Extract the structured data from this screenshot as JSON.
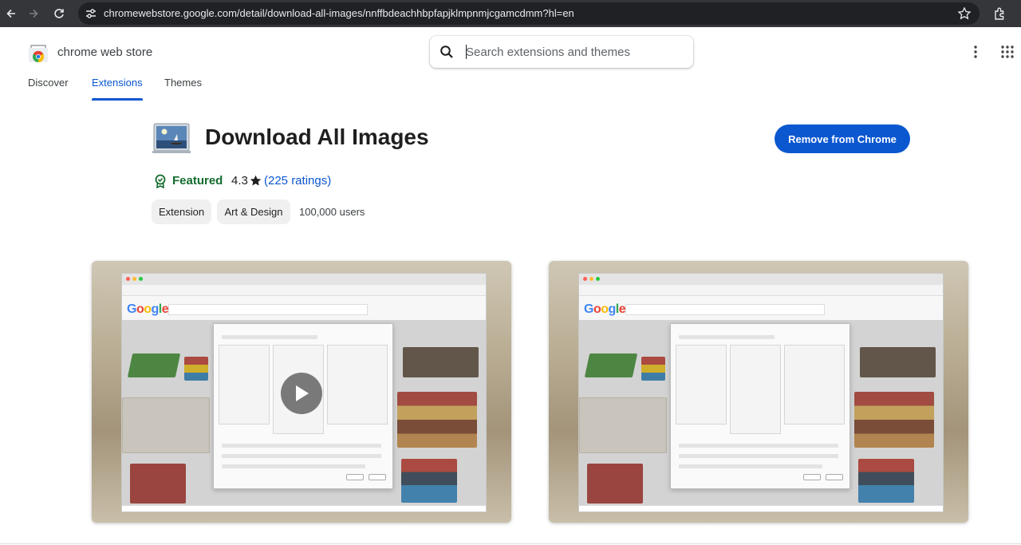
{
  "browser": {
    "url": "chromewebstore.google.com/detail/download-all-images/nnffbdeachhbpfapjklmpnmjcgamcdmm?hl=en"
  },
  "store": {
    "name": "chrome web store",
    "search_placeholder": "Search extensions and themes"
  },
  "nav_tabs": [
    {
      "label": "Discover",
      "active": false
    },
    {
      "label": "Extensions",
      "active": true
    },
    {
      "label": "Themes",
      "active": false
    }
  ],
  "extension": {
    "title": "Download All Images",
    "action_label": "Remove from Chrome",
    "featured_label": "Featured",
    "rating": "4.3",
    "rating_count": "(225 ratings)",
    "category_chips": [
      "Extension",
      "Art & Design"
    ],
    "users": "100,000 users"
  },
  "screenshots": [
    {
      "has_video": true
    },
    {
      "has_video": false
    }
  ],
  "colors": {
    "accent": "#0b57d0",
    "featured": "#146c2e",
    "browser_bar": "#35363a"
  }
}
